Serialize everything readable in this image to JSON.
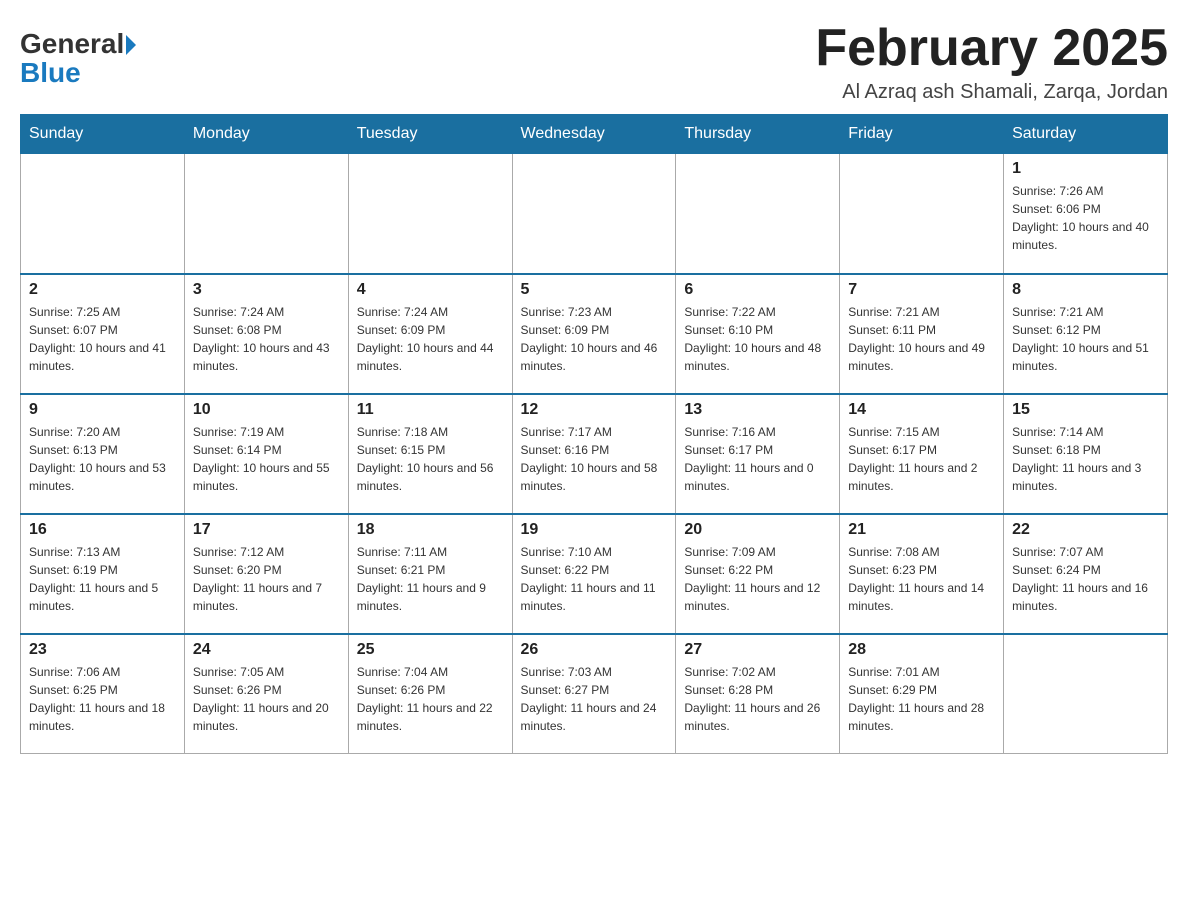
{
  "header": {
    "logo_general": "General",
    "logo_blue": "Blue",
    "month_title": "February 2025",
    "location": "Al Azraq ash Shamali, Zarqa, Jordan"
  },
  "days_of_week": [
    "Sunday",
    "Monday",
    "Tuesday",
    "Wednesday",
    "Thursday",
    "Friday",
    "Saturday"
  ],
  "weeks": [
    [
      {
        "day": "",
        "info": ""
      },
      {
        "day": "",
        "info": ""
      },
      {
        "day": "",
        "info": ""
      },
      {
        "day": "",
        "info": ""
      },
      {
        "day": "",
        "info": ""
      },
      {
        "day": "",
        "info": ""
      },
      {
        "day": "1",
        "info": "Sunrise: 7:26 AM\nSunset: 6:06 PM\nDaylight: 10 hours and 40 minutes."
      }
    ],
    [
      {
        "day": "2",
        "info": "Sunrise: 7:25 AM\nSunset: 6:07 PM\nDaylight: 10 hours and 41 minutes."
      },
      {
        "day": "3",
        "info": "Sunrise: 7:24 AM\nSunset: 6:08 PM\nDaylight: 10 hours and 43 minutes."
      },
      {
        "day": "4",
        "info": "Sunrise: 7:24 AM\nSunset: 6:09 PM\nDaylight: 10 hours and 44 minutes."
      },
      {
        "day": "5",
        "info": "Sunrise: 7:23 AM\nSunset: 6:09 PM\nDaylight: 10 hours and 46 minutes."
      },
      {
        "day": "6",
        "info": "Sunrise: 7:22 AM\nSunset: 6:10 PM\nDaylight: 10 hours and 48 minutes."
      },
      {
        "day": "7",
        "info": "Sunrise: 7:21 AM\nSunset: 6:11 PM\nDaylight: 10 hours and 49 minutes."
      },
      {
        "day": "8",
        "info": "Sunrise: 7:21 AM\nSunset: 6:12 PM\nDaylight: 10 hours and 51 minutes."
      }
    ],
    [
      {
        "day": "9",
        "info": "Sunrise: 7:20 AM\nSunset: 6:13 PM\nDaylight: 10 hours and 53 minutes."
      },
      {
        "day": "10",
        "info": "Sunrise: 7:19 AM\nSunset: 6:14 PM\nDaylight: 10 hours and 55 minutes."
      },
      {
        "day": "11",
        "info": "Sunrise: 7:18 AM\nSunset: 6:15 PM\nDaylight: 10 hours and 56 minutes."
      },
      {
        "day": "12",
        "info": "Sunrise: 7:17 AM\nSunset: 6:16 PM\nDaylight: 10 hours and 58 minutes."
      },
      {
        "day": "13",
        "info": "Sunrise: 7:16 AM\nSunset: 6:17 PM\nDaylight: 11 hours and 0 minutes."
      },
      {
        "day": "14",
        "info": "Sunrise: 7:15 AM\nSunset: 6:17 PM\nDaylight: 11 hours and 2 minutes."
      },
      {
        "day": "15",
        "info": "Sunrise: 7:14 AM\nSunset: 6:18 PM\nDaylight: 11 hours and 3 minutes."
      }
    ],
    [
      {
        "day": "16",
        "info": "Sunrise: 7:13 AM\nSunset: 6:19 PM\nDaylight: 11 hours and 5 minutes."
      },
      {
        "day": "17",
        "info": "Sunrise: 7:12 AM\nSunset: 6:20 PM\nDaylight: 11 hours and 7 minutes."
      },
      {
        "day": "18",
        "info": "Sunrise: 7:11 AM\nSunset: 6:21 PM\nDaylight: 11 hours and 9 minutes."
      },
      {
        "day": "19",
        "info": "Sunrise: 7:10 AM\nSunset: 6:22 PM\nDaylight: 11 hours and 11 minutes."
      },
      {
        "day": "20",
        "info": "Sunrise: 7:09 AM\nSunset: 6:22 PM\nDaylight: 11 hours and 12 minutes."
      },
      {
        "day": "21",
        "info": "Sunrise: 7:08 AM\nSunset: 6:23 PM\nDaylight: 11 hours and 14 minutes."
      },
      {
        "day": "22",
        "info": "Sunrise: 7:07 AM\nSunset: 6:24 PM\nDaylight: 11 hours and 16 minutes."
      }
    ],
    [
      {
        "day": "23",
        "info": "Sunrise: 7:06 AM\nSunset: 6:25 PM\nDaylight: 11 hours and 18 minutes."
      },
      {
        "day": "24",
        "info": "Sunrise: 7:05 AM\nSunset: 6:26 PM\nDaylight: 11 hours and 20 minutes."
      },
      {
        "day": "25",
        "info": "Sunrise: 7:04 AM\nSunset: 6:26 PM\nDaylight: 11 hours and 22 minutes."
      },
      {
        "day": "26",
        "info": "Sunrise: 7:03 AM\nSunset: 6:27 PM\nDaylight: 11 hours and 24 minutes."
      },
      {
        "day": "27",
        "info": "Sunrise: 7:02 AM\nSunset: 6:28 PM\nDaylight: 11 hours and 26 minutes."
      },
      {
        "day": "28",
        "info": "Sunrise: 7:01 AM\nSunset: 6:29 PM\nDaylight: 11 hours and 28 minutes."
      },
      {
        "day": "",
        "info": ""
      }
    ]
  ]
}
